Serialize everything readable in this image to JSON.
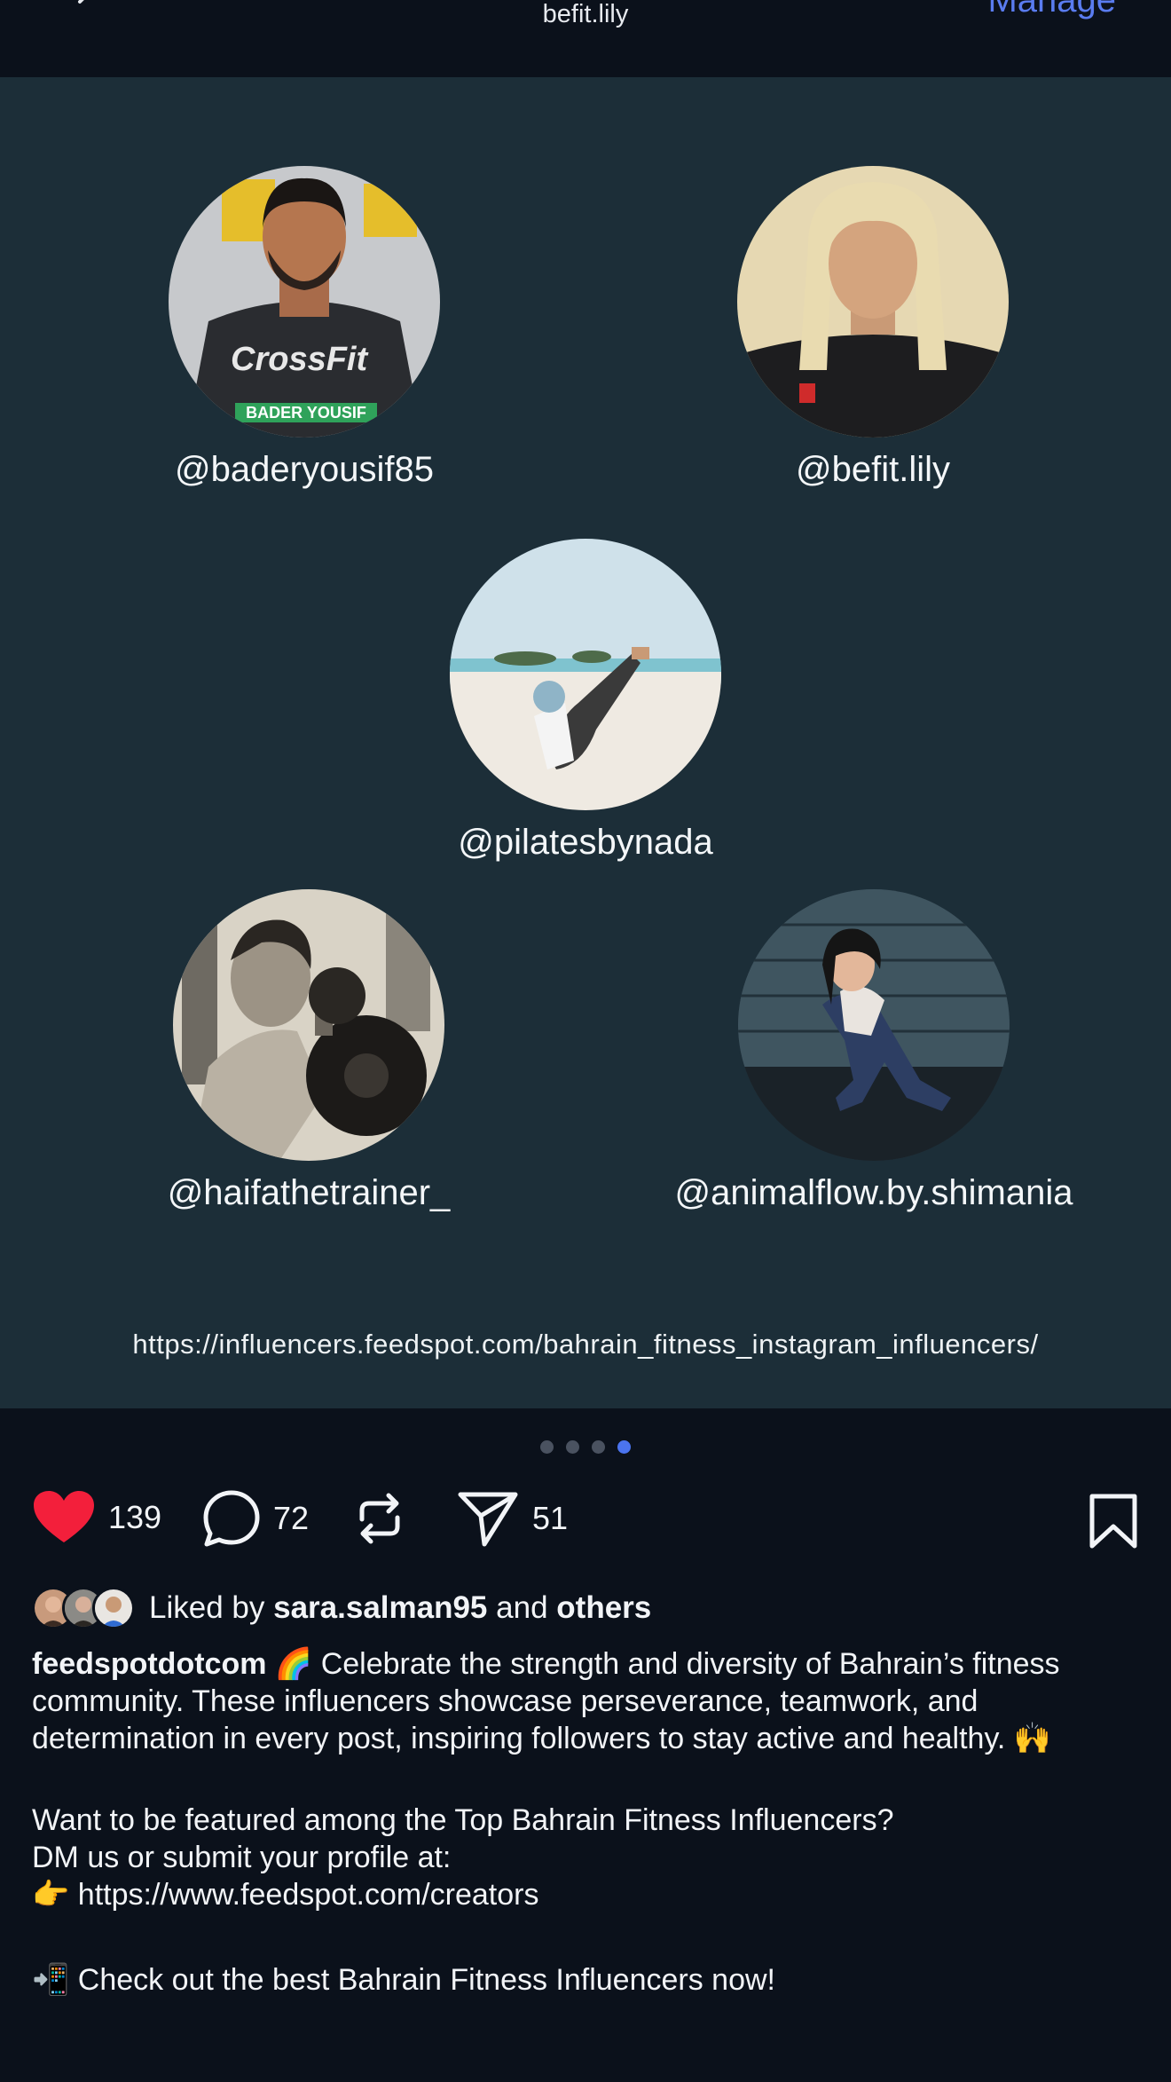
{
  "header": {
    "title": "befit.lily",
    "manage_label": "Manage"
  },
  "post": {
    "profiles": [
      {
        "handle": "@baderyousif85",
        "avatar_text": "BADER YOUSIF"
      },
      {
        "handle": "@befit.lily"
      },
      {
        "handle": "@pilatesbynada"
      },
      {
        "handle": "@haifathetrainer_"
      },
      {
        "handle": "@animalflow.by.shimania"
      }
    ],
    "url": "https://influencers.feedspot.com/bahrain_fitness_instagram_influencers/"
  },
  "carousel": {
    "total": 4,
    "active_index": 4
  },
  "actions": {
    "likes": "139",
    "comments": "72",
    "reposts": "",
    "shares": "51"
  },
  "liked_by": {
    "prefix": "Liked by",
    "user": "sara.salman95",
    "and": "and",
    "others": "others"
  },
  "caption": {
    "author": "feedspotdotcom",
    "rainbow": "🌈",
    "text": "Celebrate the strength and diversity of Bahrain’s fitness community. These influencers showcase perseverance, teamwork, and determination in every post, inspiring followers to stay active and healthy.",
    "hands": "🙌",
    "line2": "Want to be featured among the Top Bahrain Fitness Influencers?",
    "line3": "DM us or submit your profile at:",
    "pointer": "👉",
    "link": "https://www.feedspot.com/creators",
    "phone": "📲",
    "line5": "Check out the best Bahrain Fitness Influencers now!"
  },
  "colors": {
    "background": "#0b111b",
    "post_bg": "#1c2e38",
    "accent": "#4b74ef",
    "like": "#f31f3b"
  }
}
